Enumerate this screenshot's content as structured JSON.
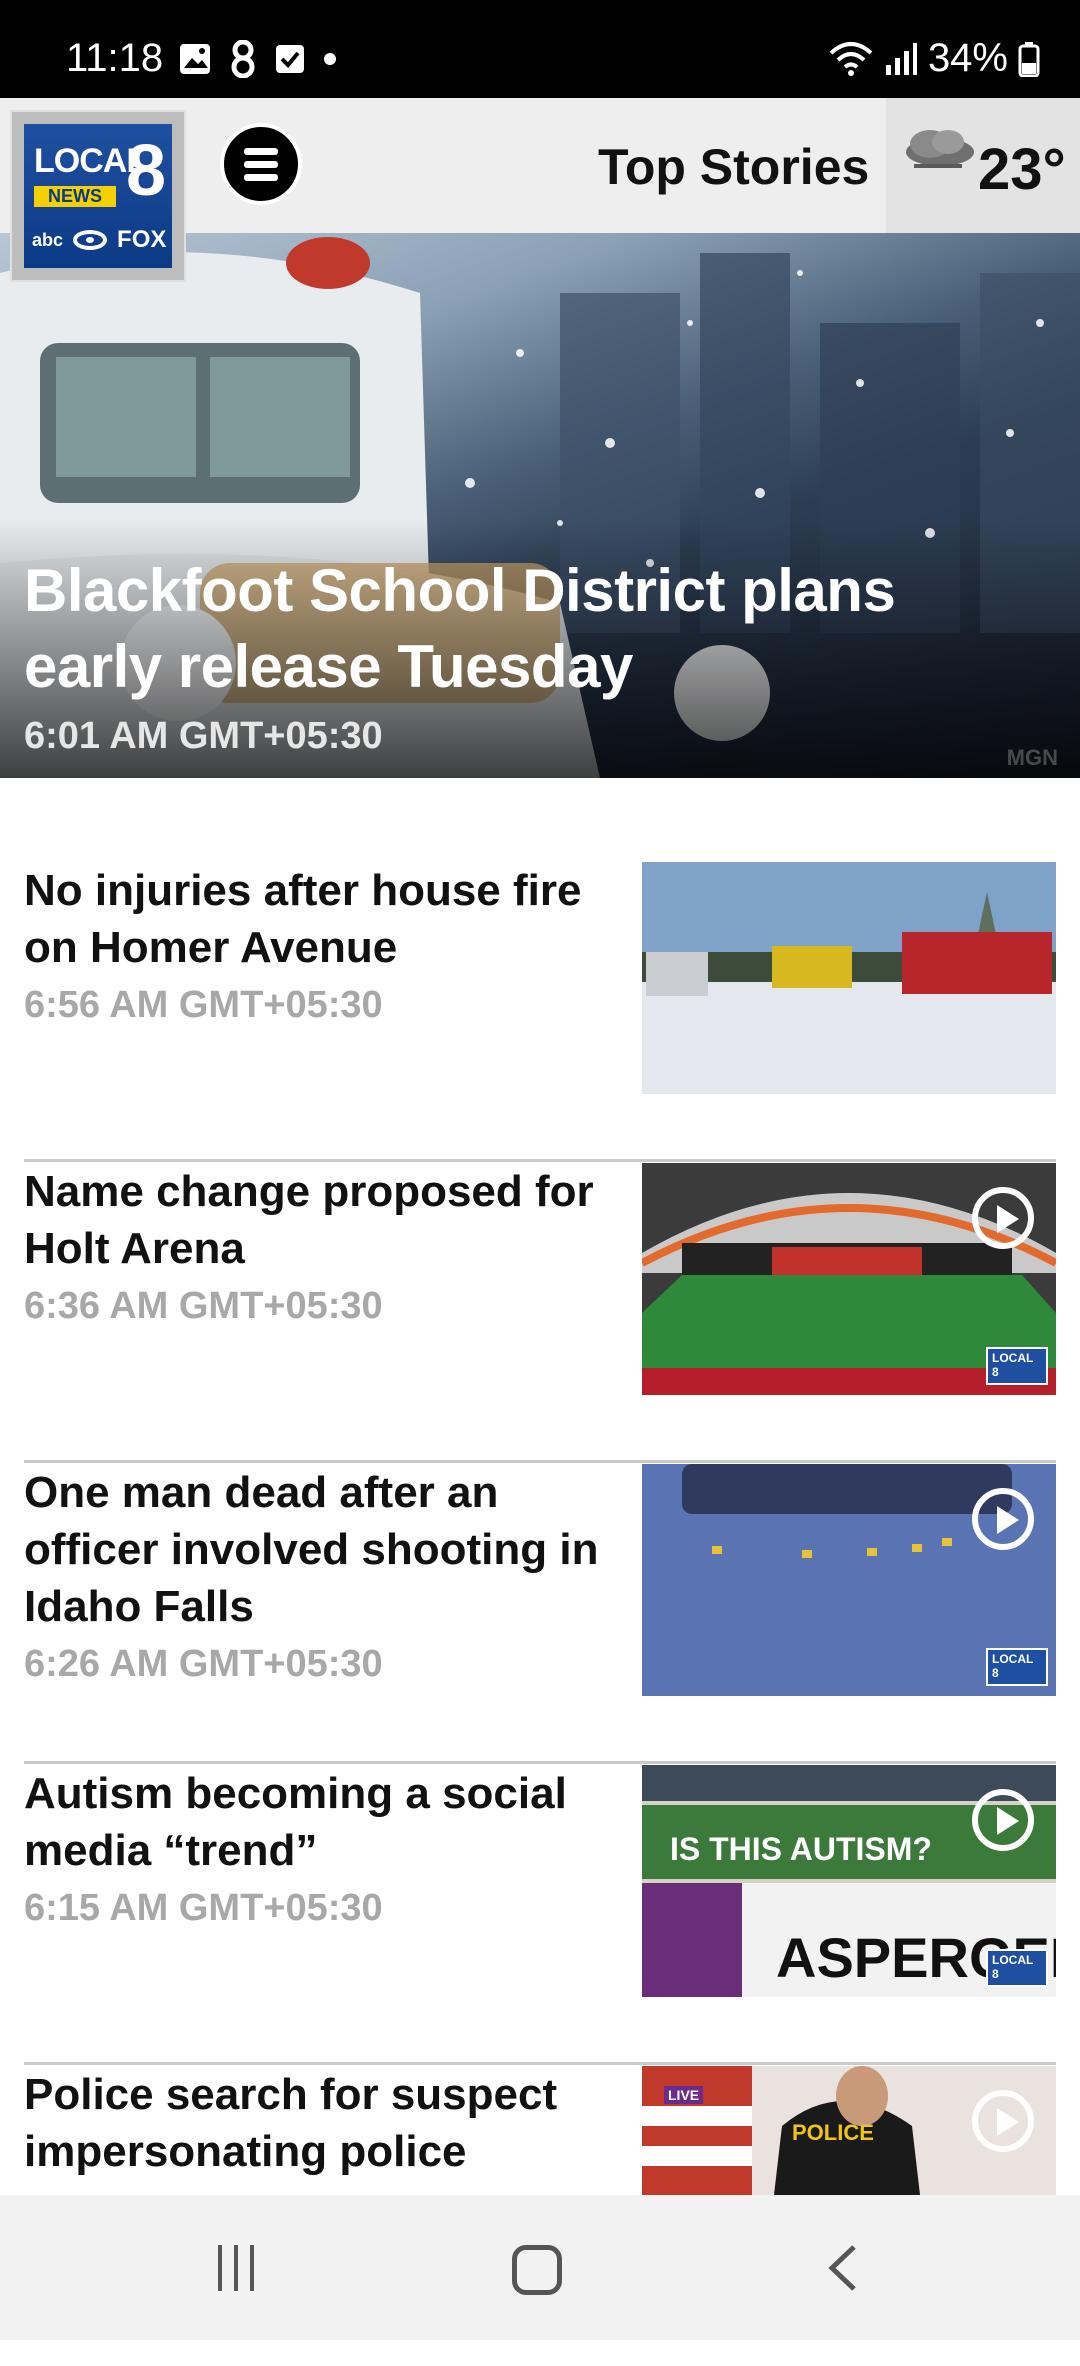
{
  "status_bar": {
    "time": "11:18",
    "battery": "34%",
    "icons": [
      "gallery-icon",
      "app-8-icon",
      "checkbox-icon",
      "dot-icon",
      "wifi-icon",
      "signal-icon",
      "battery-icon"
    ]
  },
  "header": {
    "logo": {
      "line1": "LOCAL",
      "number": "8",
      "tag": "NEWS",
      "networks": [
        "abc",
        "FOX"
      ]
    },
    "title": "Top Stories",
    "weather": {
      "temperature": "23°",
      "icon": "cloud-icon"
    }
  },
  "hero": {
    "title": "Blackfoot School District plans early release Tuesday",
    "time": "6:01 AM GMT+05:30",
    "credit": "MGN"
  },
  "stories": [
    {
      "title": "No injuries after house fire on Homer Avenue",
      "time": "6:56 AM GMT+05:30",
      "video": false
    },
    {
      "title": "Name change proposed for Holt Arena",
      "time": "6:36 AM GMT+05:30",
      "video": true
    },
    {
      "title": "One man dead after an officer involved shooting in Idaho Falls",
      "time": "6:26 AM GMT+05:30",
      "video": true
    },
    {
      "title": "Autism becoming a social media “trend”",
      "time": "6:15 AM GMT+05:30",
      "video": true,
      "thumb_text": [
        "IS THIS AUTISM?",
        "ASPERGER"
      ]
    },
    {
      "title": "Police search for suspect impersonating police",
      "time": "",
      "video": true,
      "thumb_text": [
        "POLICE",
        "LIVE"
      ]
    }
  ],
  "colors": {
    "status_bar": "#000000",
    "header_bg": "#eeeeee",
    "logo_blue": "#0b3a86",
    "logo_yellow": "#f5d000",
    "divider": "#c9c9c9",
    "timestamp": "#a8a8a8"
  },
  "nav_bar": {
    "icons": [
      "recents-icon",
      "home-icon",
      "back-icon"
    ]
  }
}
